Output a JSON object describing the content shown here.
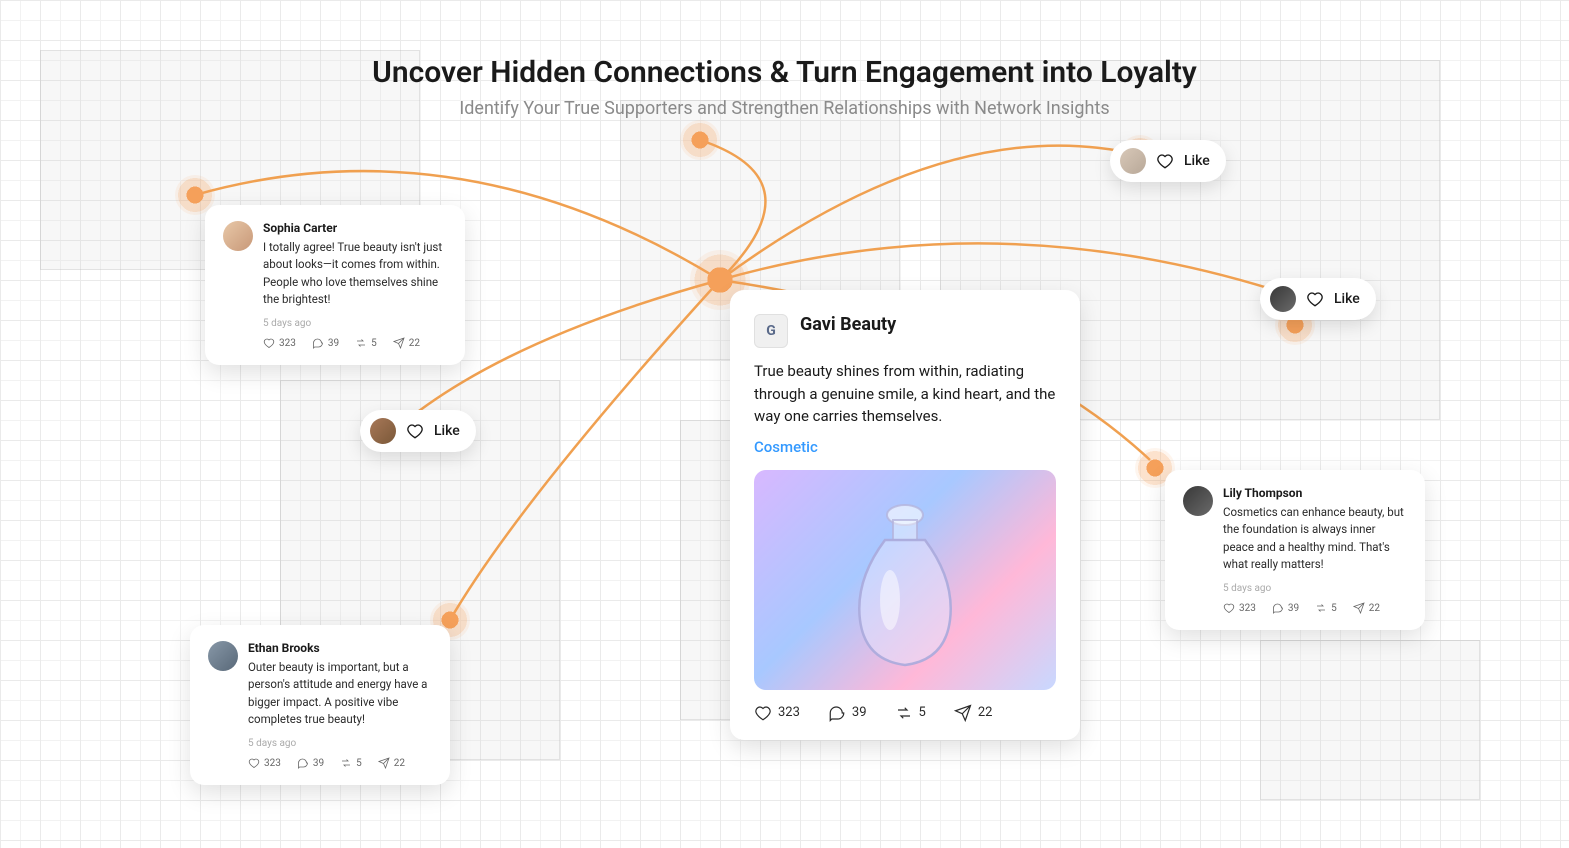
{
  "header": {
    "title": "Uncover Hidden Connections & Turn Engagement into Loyalty",
    "subtitle": "Identify Your True Supporters and Strengthen Relationships with Network Insights"
  },
  "main_post": {
    "brand": "Gavi Beauty",
    "brand_initial": "G",
    "text": "True beauty shines from within, radiating through a genuine smile, a kind heart, and the way one carries themselves.",
    "tag": "Cosmetic",
    "likes": "323",
    "comments": "39",
    "reposts": "5",
    "shares": "22"
  },
  "comments": [
    {
      "name": "Sophia Carter",
      "text": "I totally agree! True beauty isn't just about looks—it comes from within. People who love themselves shine the brightest!",
      "time": "5 days ago",
      "likes": "323",
      "comments": "39",
      "reposts": "5",
      "shares": "22"
    },
    {
      "name": "Ethan Brooks",
      "text": "Outer beauty is important, but a person's attitude and energy have a bigger impact. A positive vibe completes true beauty!",
      "time": "5 days ago",
      "likes": "323",
      "comments": "39",
      "reposts": "5",
      "shares": "22"
    },
    {
      "name": "Lily Thompson",
      "text": "Cosmetics can enhance beauty, but the foundation is always inner peace and a healthy mind. That's what really matters!",
      "time": "5 days ago",
      "likes": "323",
      "comments": "39",
      "reposts": "5",
      "shares": "22"
    }
  ],
  "like_label": "Like"
}
